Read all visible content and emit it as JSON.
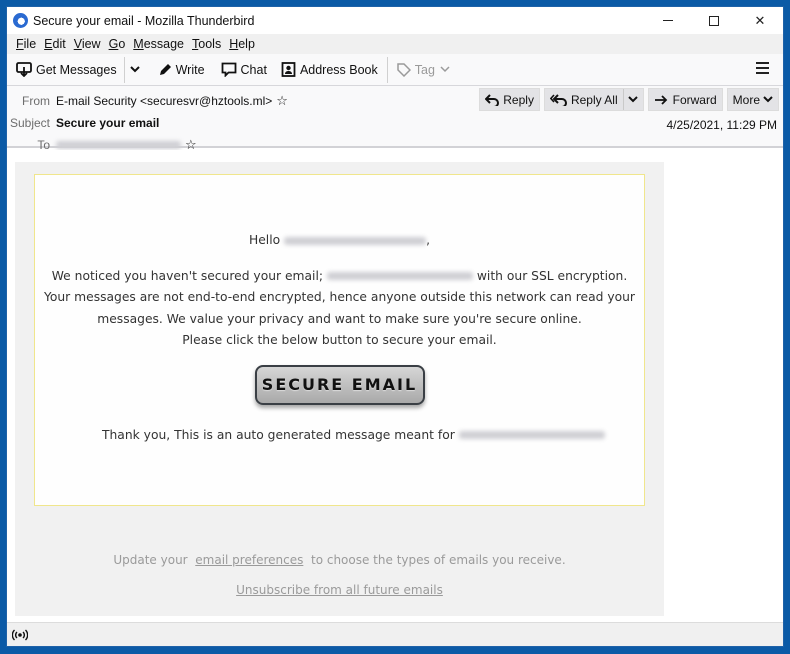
{
  "window": {
    "title": "Secure your email - Mozilla Thunderbird",
    "controls": {
      "minimize": "minimize",
      "maximize": "maximize",
      "close": "✕"
    }
  },
  "menubar": {
    "items": [
      {
        "label": "File",
        "mnemonic": "F",
        "rest": "ile"
      },
      {
        "label": "Edit",
        "mnemonic": "E",
        "rest": "dit"
      },
      {
        "label": "View",
        "mnemonic": "V",
        "rest": "iew"
      },
      {
        "label": "Go",
        "mnemonic": "G",
        "rest": "o"
      },
      {
        "label": "Message",
        "mnemonic": "M",
        "rest": "essage"
      },
      {
        "label": "Tools",
        "mnemonic": "T",
        "rest": "ools"
      },
      {
        "label": "Help",
        "mnemonic": "H",
        "rest": "elp"
      }
    ]
  },
  "toolbar": {
    "get_messages": "Get Messages",
    "write": "Write",
    "chat": "Chat",
    "address_book": "Address Book",
    "tag": "Tag"
  },
  "header": {
    "from_label": "From",
    "from_value": "E-mail Security <securesvr@hztools.ml>",
    "subject_label": "Subject",
    "subject_value": "Secure your email",
    "to_label": "To",
    "to_value": "[redacted]",
    "date": "4/25/2021, 11:29 PM",
    "actions": {
      "reply": "Reply",
      "reply_all": "Reply All",
      "forward": "Forward",
      "more": "More"
    }
  },
  "email": {
    "greeting_prefix": "Hello",
    "greeting_suffix": ",",
    "line1_prefix": "We noticed you haven't secured your email;",
    "line1_suffix": "with our SSL encryption.",
    "line2": "Your messages are not end-to-end encrypted, hence anyone outside this network can read your",
    "line3": "messages. We value your privacy and want to make sure you're secure online.",
    "line4": "Please click the below button to secure your email.",
    "cta_label": "SECURE EMAIL",
    "thanks": "Thank you, This is an auto generated message meant for",
    "footer_prefix": "Update your",
    "footer_link": "email preferences",
    "footer_suffix": "to choose the types of emails you receive.",
    "unsubscribe": "Unsubscribe from all future emails"
  },
  "colors": {
    "accent": "#0b5aa6",
    "panel_bg": "#f1f1f1",
    "inner_border": "#f0e68c"
  }
}
